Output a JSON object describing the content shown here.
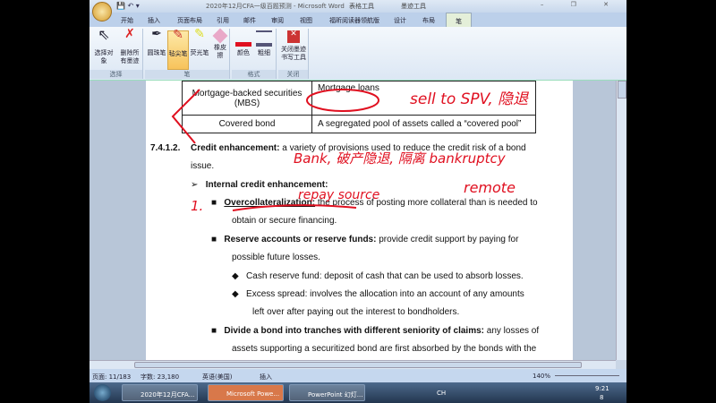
{
  "window": {
    "title": "2020年12月CFA一级百题预测 - Microsoft Word",
    "context_tab1": "表格工具",
    "context_tab2": "墨迹工具",
    "controls": "– ❐ ✕"
  },
  "tabs": [
    "开始",
    "插入",
    "页面布局",
    "引用",
    "邮件",
    "审阅",
    "视图",
    "福昕阅读器领航版",
    "设计",
    "布局",
    "笔"
  ],
  "ribbon": {
    "groups": [
      "选择",
      "笔",
      "格式",
      "关闭"
    ],
    "buttons": {
      "select": "选择对象",
      "delete_all": "删除所有墨迹",
      "ballpoint": "圆珠笔",
      "felt": "毡尖笔",
      "highlighter": "荧光笔",
      "eraser": "橡皮擦",
      "color": "颜色",
      "thickness": "粗细",
      "close_ink": "关闭墨迹书写工具"
    }
  },
  "document": {
    "table": [
      [
        "Mortgage-backed securities (MBS)",
        "Mortgage loans"
      ],
      [
        "Covered bond",
        "A segregated pool of assets called a “covered pool”"
      ]
    ],
    "heading_num": "7.4.1.2.",
    "heading_bold": "Credit enhancement:",
    "heading_rest": " a variety of provisions used to reduce the credit risk of a bond",
    "heading_cont": "issue.",
    "internal": "Internal credit enhancement:",
    "items": [
      {
        "bold": "Overcollateralization:",
        "text": " the process of posting more collateral than is needed to",
        "cont": "obtain or secure financing."
      },
      {
        "bold": "Reserve accounts or reserve funds:",
        "text": " provide credit support by paying for",
        "cont": "possible future losses."
      },
      {
        "bold": "Divide a bond into tranches with different seniority of claims:",
        "text": " any losses of",
        "cont": "assets supporting a securitized bond are first absorbed by the bonds with the"
      }
    ],
    "subitems": [
      {
        "text": "Cash reserve fund: deposit of cash that can be used to absorb losses."
      },
      {
        "text": "Excess spread: involves the allocation into an account of any amounts",
        "cont": "left over after paying out the interest to bondholders."
      }
    ],
    "ink_notes": [
      "sell to SPV, 隐退",
      "Bank, 破产隐退, 隔离 bankruptcy",
      "repay source",
      "remote",
      "1."
    ]
  },
  "status": {
    "page": "页面: 11/183",
    "words": "字数: 23,180",
    "lang": "英语(美国)",
    "mode": "插入",
    "zoom": "140%"
  },
  "taskbar": {
    "tasks": [
      "2020年12月CFA...",
      "Microsoft Powe...",
      "PowerPoint 幻灯..."
    ],
    "tray": "CH",
    "time": "9:21",
    "date": "8"
  },
  "colors": {
    "ink": "#e01020",
    "accent": "#f7c35b"
  }
}
